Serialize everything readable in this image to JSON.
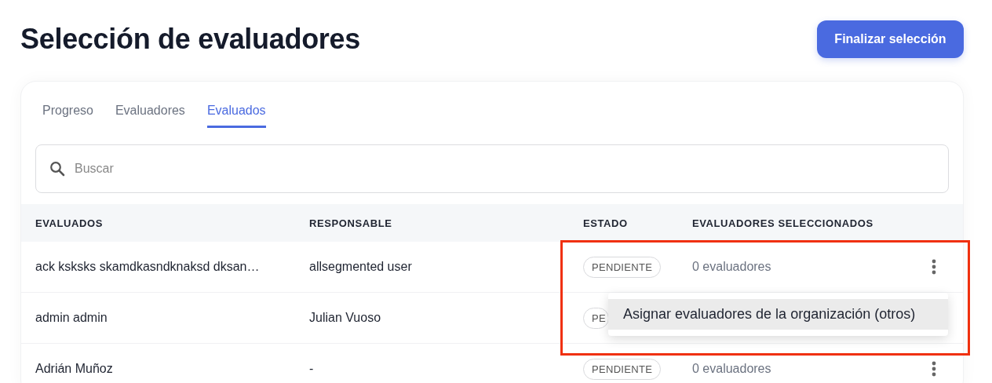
{
  "title": "Selección de evaluadores",
  "finish_button": "Finalizar selección",
  "tabs": [
    {
      "label": "Progreso",
      "selected": false
    },
    {
      "label": "Evaluadores",
      "selected": false
    },
    {
      "label": "Evaluados",
      "selected": true
    }
  ],
  "search": {
    "placeholder": "Buscar"
  },
  "table": {
    "columns": [
      "EVALUADOS",
      "RESPONSABLE",
      "ESTADO",
      "EVALUADORES SELECCIONADOS"
    ],
    "rows": [
      {
        "evaluado": "ack ksksks skamdkasndknaksd dksan…",
        "responsable": "allsegmented user",
        "estado": "PENDIENTE",
        "evaluadores": "0 evaluadores",
        "menu_button": true
      },
      {
        "evaluado": "admin admin",
        "responsable": "Julian Vuoso",
        "estado": "PE",
        "menu_button": false
      },
      {
        "evaluado": "Adrián Muñoz",
        "responsable": "-",
        "estado": "PENDIENTE",
        "evaluadores": "0 evaluadores",
        "menu_button": true
      }
    ]
  },
  "context_menu": {
    "items": [
      {
        "label": "Asignar evaluadores de la organización (otros)",
        "selected": true
      }
    ]
  },
  "highlight_frame": true
}
